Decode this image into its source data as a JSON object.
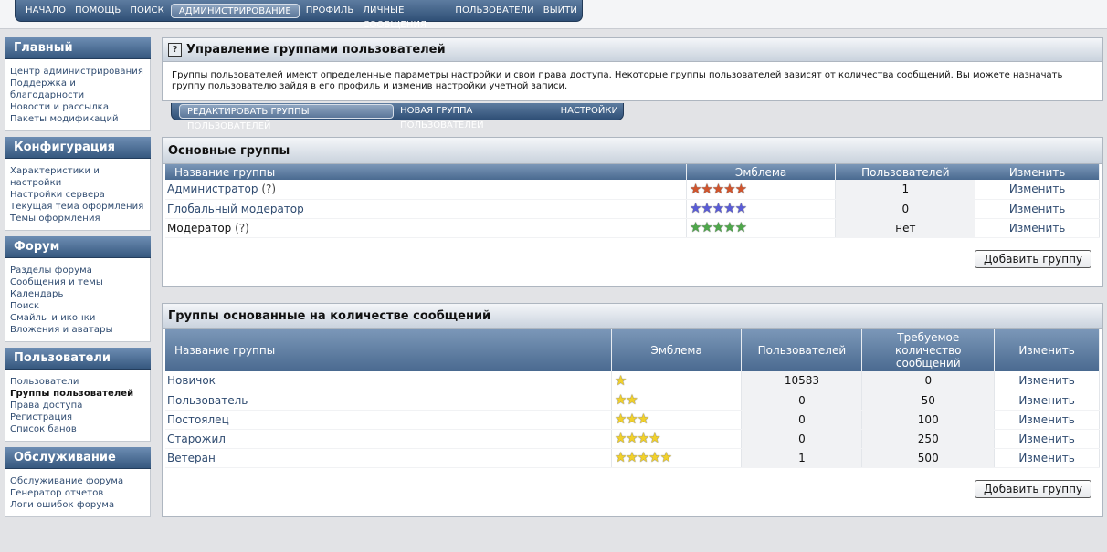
{
  "topnav": {
    "items": [
      "НАЧАЛО",
      "ПОМОЩЬ",
      "ПОИСК",
      "АДМИНИСТРИРОВАНИЕ",
      "ПРОФИЛЬ",
      "ЛИЧНЫЕ СООБЩЕНИЯ",
      "ПОЛЬЗОВАТЕЛИ",
      "ВЫЙТИ"
    ],
    "active_index": 3
  },
  "sidebar": [
    {
      "title": "Главный",
      "links": [
        "Центр администрирования",
        "Поддержка и благодарности",
        "Новости и рассылка",
        "Пакеты модификаций"
      ]
    },
    {
      "title": "Конфигурация",
      "links": [
        "Характеристики и настройки",
        "Настройки сервера",
        "Текущая тема оформления",
        "Темы оформления"
      ]
    },
    {
      "title": "Форум",
      "links": [
        "Разделы форума",
        "Сообщения и темы",
        "Календарь",
        "Поиск",
        "Смайлы и иконки",
        "Вложения и аватары"
      ]
    },
    {
      "title": "Пользователи",
      "links": [
        "Пользователи",
        "Группы пользователей",
        "Права доступа",
        "Регистрация",
        "Список банов"
      ],
      "current": "Группы пользователей"
    },
    {
      "title": "Обслуживание",
      "links": [
        "Обслуживание форума",
        "Генератор отчетов",
        "Логи ошибок форума"
      ]
    }
  ],
  "header": {
    "title": "Управление группами пользователей",
    "help_glyph": "?",
    "description": "Группы пользователей имеют определенные параметры настройки и свои права доступа. Некоторые группы пользователей зависят от количества сообщений. Вы можете назначать группу пользователю зайдя в его профиль и изменив настройки учетной записи."
  },
  "subnav": {
    "items": [
      "РЕДАКТИРОВАТЬ ГРУППЫ ПОЛЬЗОВАТЕЛЕЙ",
      "НОВАЯ ГРУППА ПОЛЬЗОВАТЕЛЕЙ",
      "НАСТРОЙКИ"
    ],
    "active_index": 0
  },
  "regular_groups": {
    "title": "Основные группы",
    "columns": [
      "Название группы",
      "Эмблема",
      "Пользователей",
      "Изменить"
    ],
    "rows": [
      {
        "name": "Администратор",
        "help": "(?)",
        "stars": 5,
        "star_color": "#d2542c",
        "users": "1",
        "edit": "Изменить",
        "link": true
      },
      {
        "name": "Глобальный модератор",
        "help": "",
        "stars": 5,
        "star_color": "#5a5cd8",
        "users": "0",
        "edit": "Изменить",
        "link": true
      },
      {
        "name": "Модератор",
        "help": "(?)",
        "stars": 5,
        "star_color": "#4ea84a",
        "users": "нет",
        "edit": "Изменить",
        "link": false
      }
    ],
    "add_button": "Добавить группу"
  },
  "post_groups": {
    "title": "Группы основанные на количестве сообщений",
    "columns": [
      "Название группы",
      "Эмблема",
      "Пользователей",
      "Требуемое количество сообщений",
      "Изменить"
    ],
    "rows": [
      {
        "name": "Новичок",
        "stars": 1,
        "users": "10583",
        "posts": "0",
        "edit": "Изменить"
      },
      {
        "name": "Пользователь",
        "stars": 2,
        "users": "0",
        "posts": "50",
        "edit": "Изменить"
      },
      {
        "name": "Постоялец",
        "stars": 3,
        "users": "0",
        "posts": "100",
        "edit": "Изменить"
      },
      {
        "name": "Старожил",
        "stars": 4,
        "users": "0",
        "posts": "250",
        "edit": "Изменить"
      },
      {
        "name": "Ветеран",
        "stars": 5,
        "users": "1",
        "posts": "500",
        "edit": "Изменить"
      }
    ],
    "star_color": "#f2d12b",
    "add_button": "Добавить группу"
  },
  "colors": {
    "nav_dark": "#2f4f76",
    "link": "#2f4b70"
  }
}
